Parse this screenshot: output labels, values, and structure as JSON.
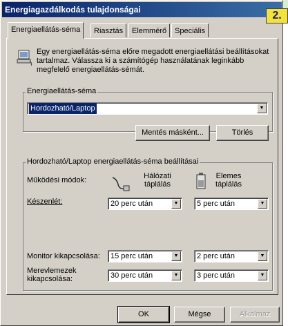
{
  "window": {
    "title": "Energiagazdálkodás tulajdonságai"
  },
  "badge": "2.",
  "tabs": [
    {
      "label": "Energiaellátás-séma",
      "active": true
    },
    {
      "label": "Riasztás"
    },
    {
      "label": "Elemmérő"
    },
    {
      "label": "Speciális"
    }
  ],
  "intro": "Egy energiaellátás-séma előre megadott energiaellátási beállításokat tartalmaz. Válassza ki a számítógép használatának leginkább megfelelő energiaellátás-sémát.",
  "scheme": {
    "group_label": "Energiaellátás-séma",
    "selected": "Hordozható/Laptop",
    "save_as_label": "Mentés másként...",
    "delete_label": "Törlés"
  },
  "settings": {
    "group_label": "Hordozható/Laptop energiaellátás-séma beállításai",
    "modes_label": "Működési módok:",
    "ac_label": "Hálózati táplálás",
    "battery_label": "Elemes táplálás",
    "standby_label": "Készenlét:",
    "standby_ac": "20 perc után",
    "standby_battery": "5 perc után",
    "monitor_label": "Monitor kikapcsolása:",
    "monitor_ac": "15 perc után",
    "monitor_battery": "2 perc után",
    "disks_label": "Merevlemezek kikapcsolása:",
    "disks_ac": "30 perc után",
    "disks_battery": "3 perc után"
  },
  "buttons": {
    "ok": "OK",
    "cancel": "Mégse",
    "apply": "Alkalmaz"
  }
}
